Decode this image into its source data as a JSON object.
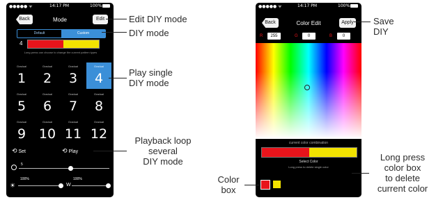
{
  "left_phone": {
    "status": {
      "time": "14:17 PM",
      "battery": "100%"
    },
    "nav": {
      "back": "Back",
      "title": "Mode",
      "edit": "Edit"
    },
    "segment": {
      "default": "Default",
      "custom": "Custom"
    },
    "current_index": "4",
    "colors": {
      "red": "#e8141b",
      "yellow": "#f2e300",
      "accent": "#3b8fd8"
    },
    "hint": "Long press can choose to change the current pattern types",
    "tiles": [
      {
        "label": "Gradual",
        "num": "1"
      },
      {
        "label": "Gradual",
        "num": "2"
      },
      {
        "label": "Gradual",
        "num": "3"
      },
      {
        "label": "Gradual",
        "num": "4"
      },
      {
        "label": "Gradual",
        "num": "5"
      },
      {
        "label": "Gradual",
        "num": "6"
      },
      {
        "label": "Gradual",
        "num": "7"
      },
      {
        "label": "Gradual",
        "num": "8"
      },
      {
        "label": "Gradual",
        "num": "9"
      },
      {
        "label": "Gradual",
        "num": "10"
      },
      {
        "label": "Gradual",
        "num": "11"
      },
      {
        "label": "Gradual",
        "num": "12"
      }
    ],
    "selected_tile": "4",
    "set_label": "Set",
    "play_label": "Play",
    "speed_value": "5",
    "speed_level": 0.5,
    "brightness_value": "100%",
    "white_value": "100%",
    "white_label": "W",
    "brightness_level": 1.0,
    "white_level": 1.0
  },
  "right_phone": {
    "status": {
      "time": "14:17 PM",
      "battery": "100%"
    },
    "nav": {
      "back": "Back",
      "title": "Color Edit",
      "apply": "Apply"
    },
    "rgb": {
      "r_label": "R",
      "r": "255",
      "g_label": "G",
      "g": "0",
      "b_label": "B",
      "b": "0"
    },
    "combo_title": "current color combination",
    "select_color": "Select Color",
    "select_hint": "Long press to delete single color"
  },
  "annotations": {
    "edit_diy": "Edit DIY mode",
    "diy_mode": "DIY mode",
    "play_single": [
      "Play single",
      "DIY mode"
    ],
    "playback": [
      "Playback loop",
      "several",
      "DIY mode"
    ],
    "save": [
      "Save",
      "DIY"
    ],
    "long_press": [
      "Long press",
      "color box",
      "to delete",
      "current color"
    ],
    "color_box": [
      "Color",
      "box"
    ]
  }
}
